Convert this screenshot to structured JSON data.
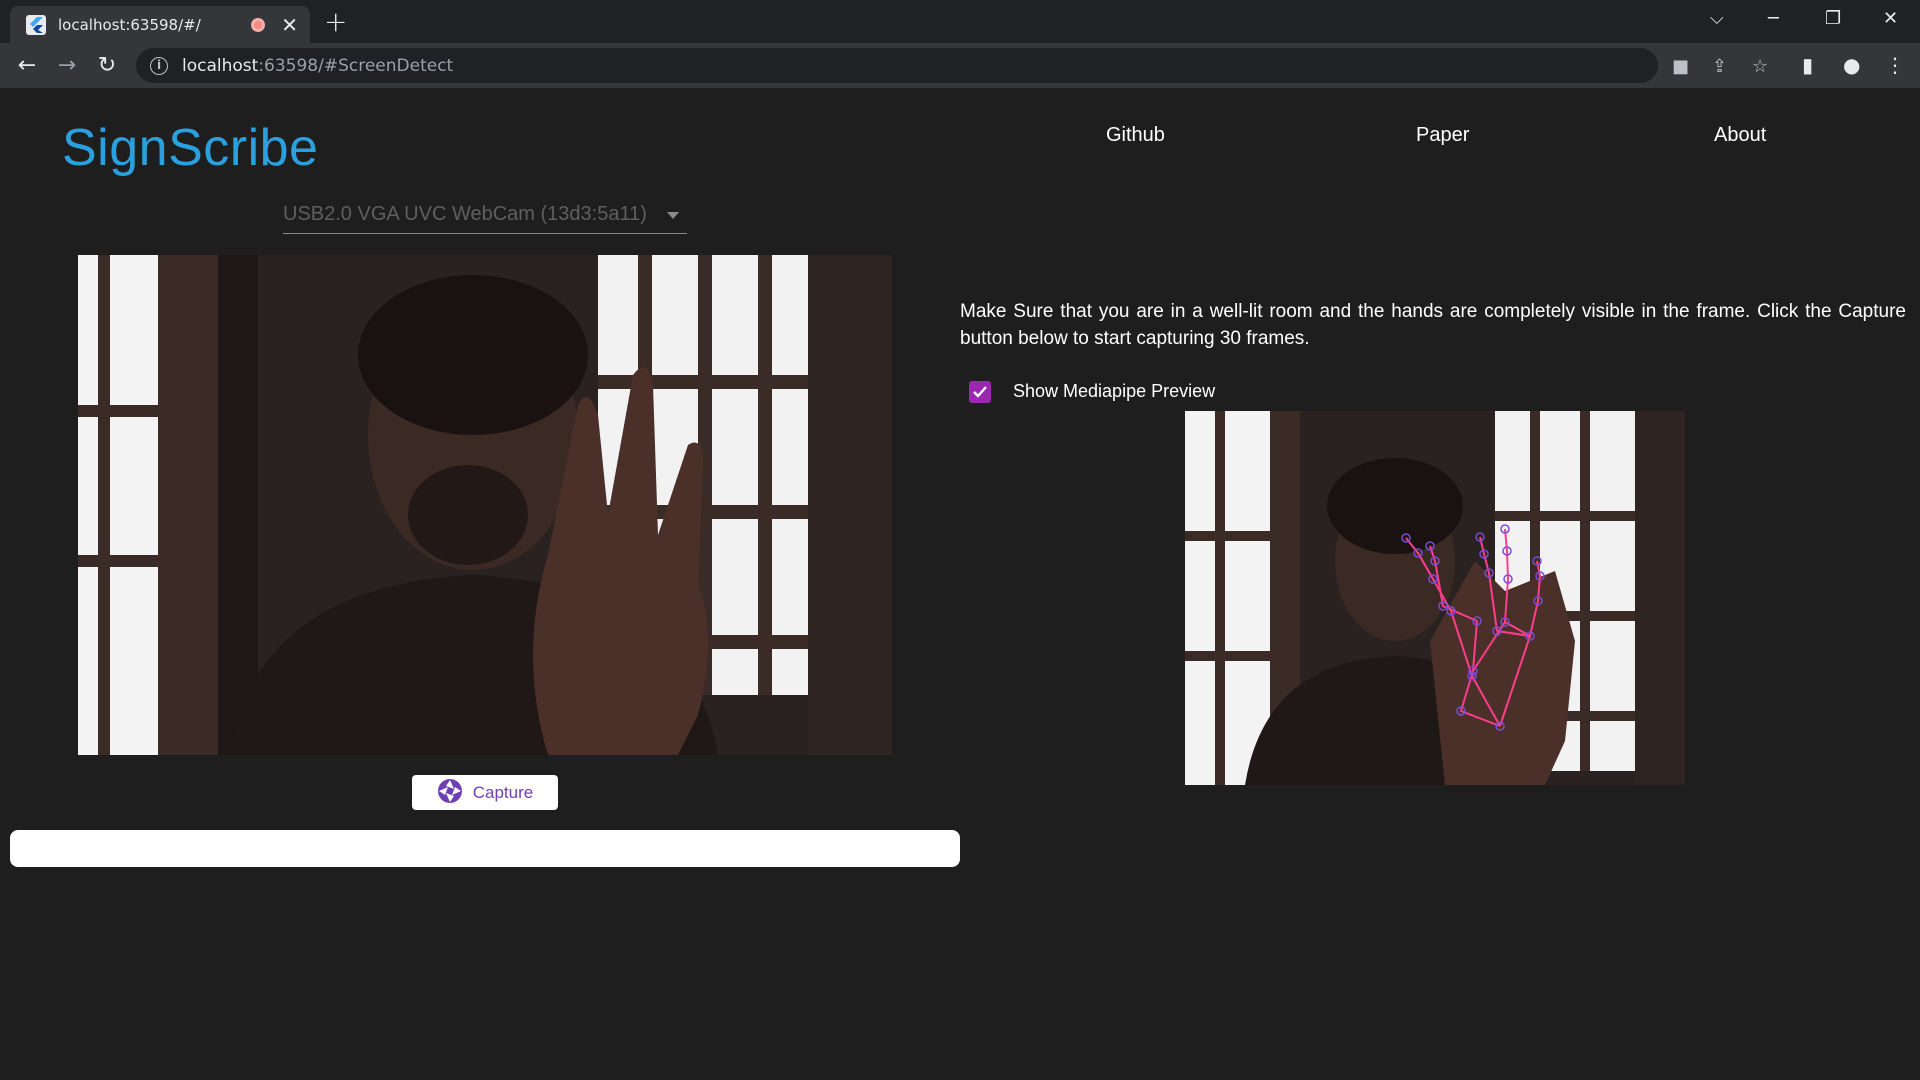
{
  "browser": {
    "tab_title": "localhost:63598/#/",
    "url_host": "localhost",
    "url_rest": ":63598/#ScreenDetect",
    "new_tab_label": "+",
    "close_tab_label": "✕"
  },
  "app": {
    "brand": "SignScribe",
    "nav": [
      "Github",
      "Paper",
      "About"
    ]
  },
  "camera": {
    "selected_device": "USB2.0 VGA UVC WebCam (13d3:5a11)"
  },
  "capture": {
    "button_label": "Capture",
    "progress_fraction": 0
  },
  "instructions": {
    "text": "Make Sure that you are in a well-lit room and the hands are completely visible in the frame. Click the Capture button below to start capturing 30 frames."
  },
  "preview": {
    "checkbox_label": "Show Mediapipe Preview",
    "checked": true
  },
  "colors": {
    "brand": "#2ba0df",
    "accent": "#6f3fb5",
    "checkbox": "#9c27b0",
    "landmark_line": "#ff3d8b",
    "background": "#1e1e1e"
  },
  "icons": [
    "back-arrow-icon",
    "forward-arrow-icon",
    "reload-icon",
    "info-icon",
    "camera-icon",
    "share-icon",
    "star-icon",
    "side-panel-icon",
    "profile-icon",
    "more-icon",
    "aperture-icon",
    "check-icon"
  ]
}
